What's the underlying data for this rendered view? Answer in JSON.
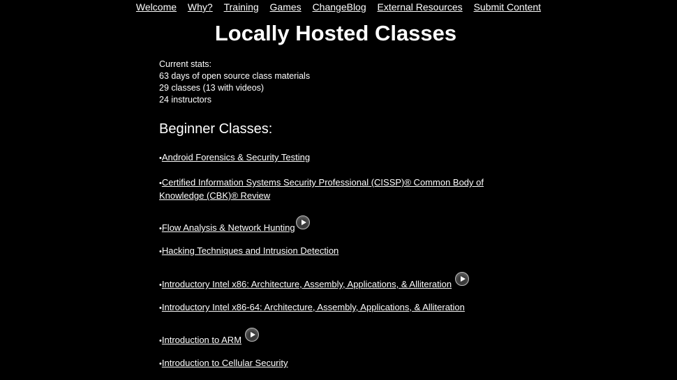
{
  "nav": [
    {
      "label": "Welcome"
    },
    {
      "label": "Why?"
    },
    {
      "label": "Training"
    },
    {
      "label": "Games"
    },
    {
      "label": "ChangeBlog"
    },
    {
      "label": "External Resources"
    },
    {
      "label": "Submit Content"
    }
  ],
  "page_title": "Locally Hosted Classes",
  "stats": {
    "heading": "Current stats:",
    "lines": [
      "63 days of open source class materials",
      "29 classes (13 with videos)",
      "24 instructors"
    ]
  },
  "section_title": "Beginner Classes:",
  "bullet": "•",
  "classes": [
    {
      "label": "Android Forensics & Security Testing",
      "video": false
    },
    {
      "label": "Certified Information Systems Security Professional (CISSP)® Common Body of Knowledge (CBK)® Review",
      "video": false
    },
    {
      "label": "Flow Analysis & Network Hunting",
      "video": true,
      "video_icon": "play-icon"
    },
    {
      "label": "Hacking Techniques and Intrusion Detection",
      "video": false
    },
    {
      "label": "Introductory Intel x86: Architecture, Assembly, Applications, & Alliteration",
      "video": true,
      "video_icon": "play-icon"
    },
    {
      "label": "Introductory Intel x86-64: Architecture, Assembly, Applications, & Alliteration",
      "video": false
    },
    {
      "label": "Introduction to ARM",
      "video": true,
      "video_icon": "play-icon"
    },
    {
      "label": "Introduction to Cellular Security",
      "video": false
    }
  ]
}
